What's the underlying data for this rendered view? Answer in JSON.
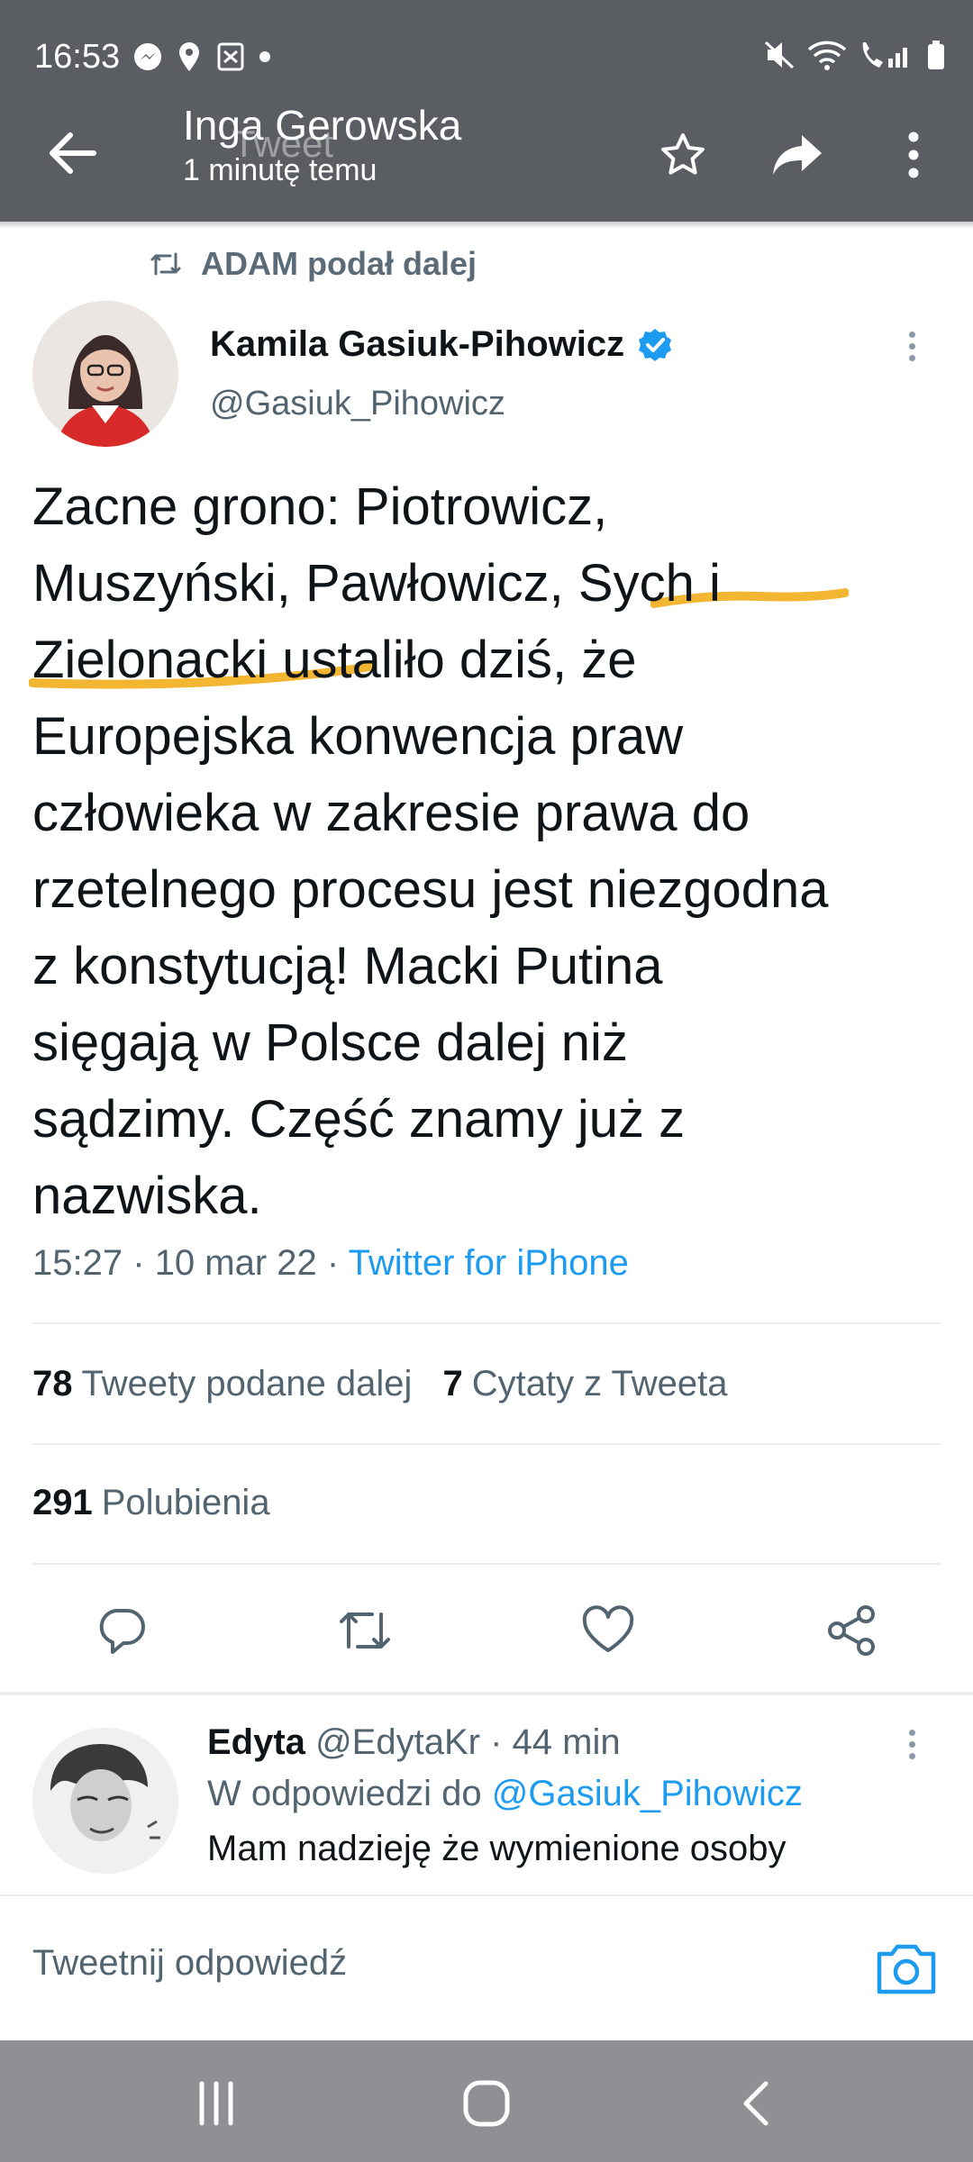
{
  "status_bar": {
    "time": "16:53"
  },
  "header": {
    "title": "Inga Gerowska",
    "subtitle": "1 minutę temu",
    "ghost_title": "Tweet"
  },
  "tweet": {
    "retweeted_by": "ADAM podał dalej",
    "author_name": "Kamila Gasiuk-Pihowicz",
    "author_handle": "@Gasiuk_Pihowicz",
    "text": "Zacne grono: Piotrowicz,\nMuszyński, Pawłowicz, Sych i\nZielonacki ustaliło dziś, że\nEuropejska konwencja praw\nczłowieka w zakresie prawa do\nrzetelnego procesu jest niezgodna\nz konstytucją! Macki Putina\nsięgają w Polsce dalej niż\nsądzimy. Część znamy już z\nnazwiska.",
    "time": "15:27",
    "date": "10 mar 22",
    "source": "Twitter for iPhone",
    "sep": "·",
    "retweets_count": "78",
    "retweets_label": "Tweety podane dalej",
    "quotes_count": "7",
    "quotes_label": "Cytaty z Tweeta",
    "likes_count": "291",
    "likes_label": "Polubienia"
  },
  "reply": {
    "name": "Edyta",
    "handle": "@EdytaKr",
    "time": "44 min",
    "in_reply_prefix": "W odpowiedzi do",
    "in_reply_handle": "@Gasiuk_Pihowicz",
    "text": "Mam nadzieję że wymienione osoby"
  },
  "compose": {
    "placeholder": "Tweetnij odpowiedź"
  },
  "colors": {
    "twitter_blue": "#1d9bf0",
    "highlighter": "#f2b632",
    "top_bar": "#5a5d61",
    "nav_bar": "#8e9094"
  }
}
